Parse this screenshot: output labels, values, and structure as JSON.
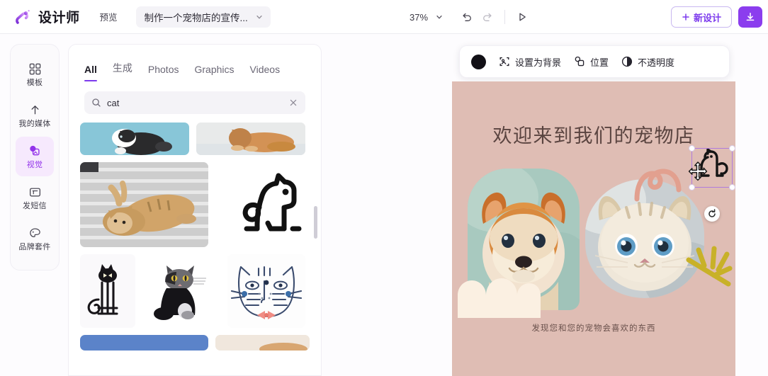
{
  "app": {
    "logo_icon": "magic-wand-logo-icon",
    "title": "设计师",
    "preview_label": "预览",
    "document_name": "制作一个宠物店的宣传...",
    "document_chevron_icon": "chevron-down-icon"
  },
  "toolbar": {
    "zoom_level": "37%",
    "zoom_chevron_icon": "chevron-down-icon",
    "undo_icon": "undo-icon",
    "redo_icon": "redo-icon",
    "present_icon": "play-triangle-icon",
    "new_design_label": "新设计",
    "new_design_plus_icon": "plus-icon",
    "download_icon": "download-icon",
    "accent_color": "#8b3dee",
    "new_design_text_color": "#7c3aed"
  },
  "sidebar": {
    "items": [
      {
        "label": "模板",
        "icon": "grid-templates-icon",
        "active": false
      },
      {
        "label": "我的媒体",
        "icon": "upload-media-icon",
        "active": false
      },
      {
        "label": "视觉",
        "icon": "visuals-shapes-icon",
        "active": true
      },
      {
        "label": "发短信",
        "icon": "text-box-icon",
        "active": false
      },
      {
        "label": "品牌套件",
        "icon": "palette-brand-icon",
        "active": false
      }
    ],
    "active_bg": "#f6e9fd",
    "active_fg": "#9333ea"
  },
  "panel": {
    "tabs": [
      {
        "label": "All",
        "active": true
      },
      {
        "label": "生成",
        "active": false
      },
      {
        "label": "Photos",
        "active": false
      },
      {
        "label": "Graphics",
        "active": false
      },
      {
        "label": "Videos",
        "active": false
      }
    ],
    "search": {
      "icon": "search-icon",
      "value": "cat",
      "placeholder": "Search",
      "clear_icon": "close-x-icon"
    },
    "results": [
      {
        "name": "black-white-kitten-photo",
        "type": "photo"
      },
      {
        "name": "ginger-cat-lying-photo",
        "type": "photo"
      },
      {
        "name": "tabby-cat-on-blanket-photo",
        "type": "photo"
      },
      {
        "name": "dog-outline-graphic",
        "type": "graphic"
      },
      {
        "name": "black-cat-sitting-graphic",
        "type": "graphic"
      },
      {
        "name": "tuxedo-cat-illustration",
        "type": "graphic"
      },
      {
        "name": "striped-cat-face-bowtie-graphic",
        "type": "graphic"
      },
      {
        "name": "blue-banner-photo",
        "type": "photo"
      },
      {
        "name": "light-beige-photo",
        "type": "photo"
      }
    ],
    "scrollbar": "vertical-scrollbar"
  },
  "float_toolbar": {
    "color_swatch": "#121016",
    "items": [
      {
        "label": "设置为背景",
        "icon": "set-as-background-icon"
      },
      {
        "label": "位置",
        "icon": "position-layers-icon"
      },
      {
        "label": "不透明度",
        "icon": "opacity-half-circle-icon"
      }
    ]
  },
  "canvas": {
    "background_color": "#dfbdb4",
    "heading": "欢迎来到我们的宠物店",
    "heading_color": "#5a4440",
    "caption": "发现您和您的宠物会喜欢的东西",
    "caption_color": "#6a514c",
    "elements": [
      {
        "name": "puppy-photo",
        "type": "image"
      },
      {
        "name": "kitten-photo",
        "type": "image"
      },
      {
        "name": "cloud-shape",
        "type": "shape",
        "color": "#fbf0e2"
      },
      {
        "name": "pink-swirl-decoration",
        "type": "shape",
        "color": "#e4a191"
      },
      {
        "name": "olive-leaf-decoration",
        "type": "shape",
        "color": "#c9b226"
      },
      {
        "name": "cat-outline-graphic",
        "type": "graphic",
        "selected": true
      }
    ],
    "selection": {
      "border_color": "#b07bdd",
      "handle_icon": "resize-handle",
      "rotate_icon": "rotate-icon",
      "move_cursor_icon": "move-cursor-icon"
    }
  }
}
